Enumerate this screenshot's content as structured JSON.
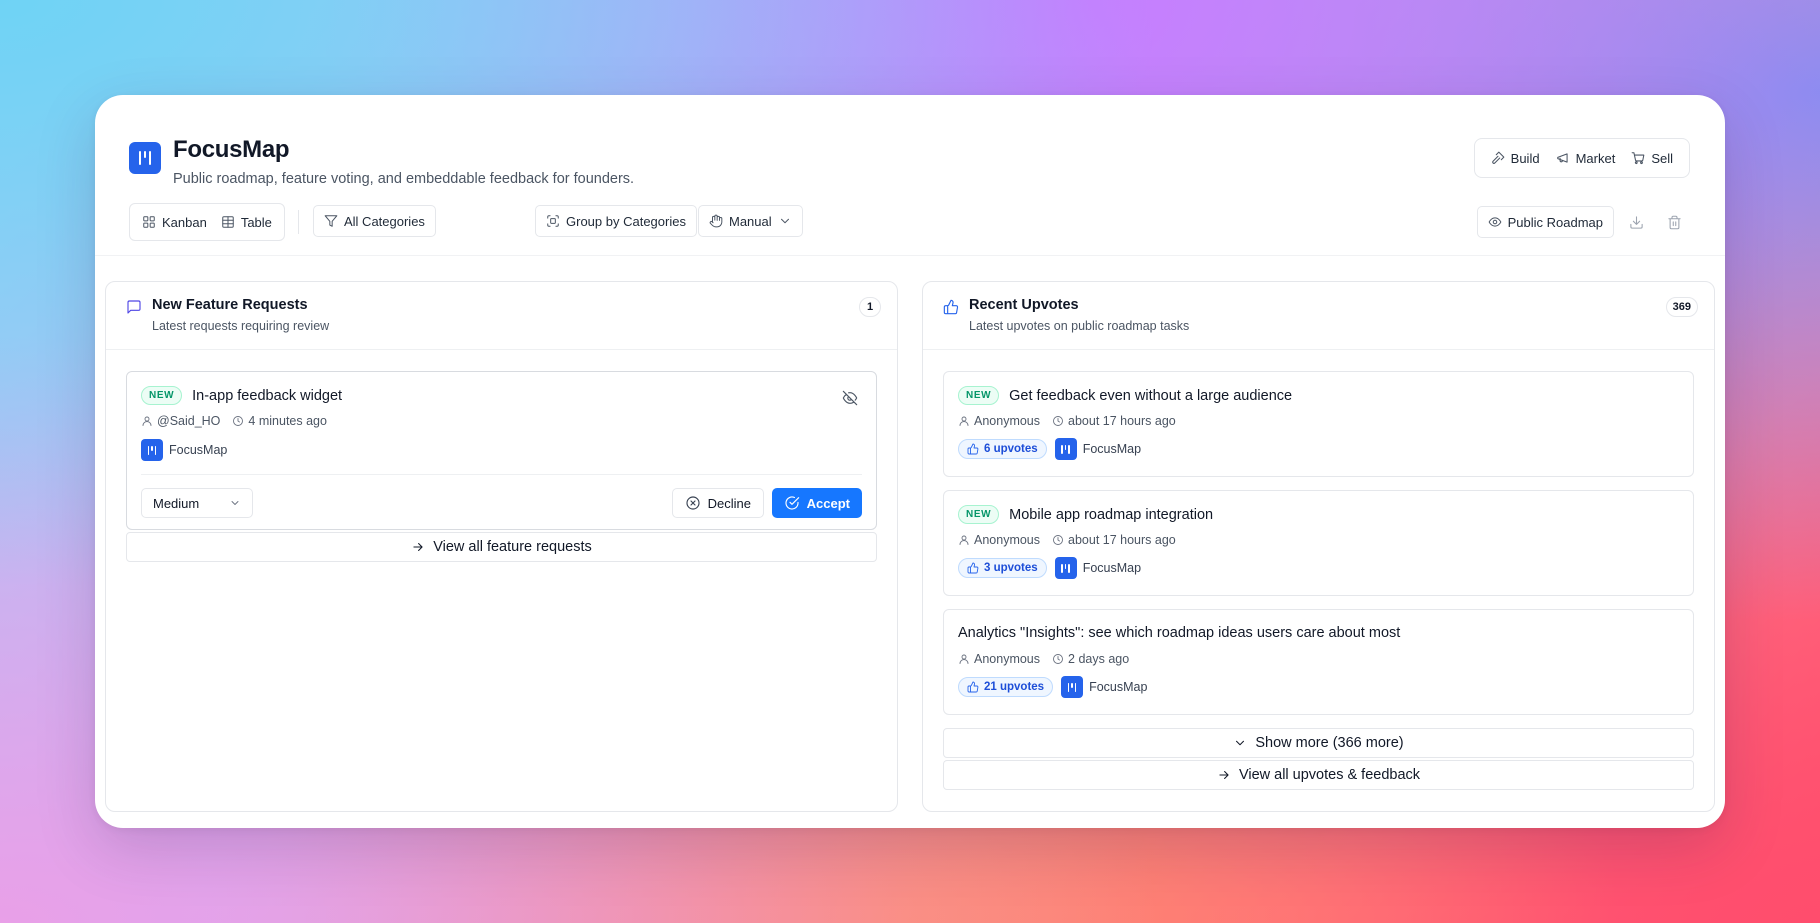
{
  "app": {
    "title": "FocusMap",
    "subtitle": "Public roadmap, feature voting, and embeddable feedback for founders.",
    "brand_color": "#2563eb"
  },
  "top_nav": [
    {
      "label": "Build",
      "icon": "hammer-icon"
    },
    {
      "label": "Market",
      "icon": "megaphone-icon"
    },
    {
      "label": "Sell",
      "icon": "cart-icon"
    }
  ],
  "toolbar": {
    "views": [
      {
        "label": "Kanban",
        "icon": "grid-icon"
      },
      {
        "label": "Table",
        "icon": "table-icon"
      }
    ],
    "filter_label": "All Categories",
    "group_label": "Group by Categories",
    "sort_label": "Manual",
    "public_roadmap_label": "Public Roadmap"
  },
  "feature_requests": {
    "title": "New Feature Requests",
    "description": "Latest requests requiring review",
    "count": "1",
    "items": [
      {
        "badge": "NEW",
        "title": "In-app feedback widget",
        "author": "@Said_HO",
        "time": "4 minutes ago",
        "project": "FocusMap",
        "priority": "Medium",
        "decline_label": "Decline",
        "accept_label": "Accept"
      }
    ],
    "view_all_label": "View all feature requests"
  },
  "upvotes": {
    "title": "Recent Upvotes",
    "description": "Latest upvotes on public roadmap tasks",
    "count": "369",
    "items": [
      {
        "badge": "NEW",
        "title": "Get feedback even without a large audience",
        "author": "Anonymous",
        "time": "about 17 hours ago",
        "upvotes": "6 upvotes",
        "project": "FocusMap"
      },
      {
        "badge": "NEW",
        "title": "Mobile app roadmap integration",
        "author": "Anonymous",
        "time": "about 17 hours ago",
        "upvotes": "3 upvotes",
        "project": "FocusMap"
      },
      {
        "badge": "",
        "title": "Analytics \"Insights\": see which roadmap ideas users care about most",
        "author": "Anonymous",
        "time": "2 days ago",
        "upvotes": "21 upvotes",
        "project": "FocusMap"
      }
    ],
    "show_more_label": "Show more (366 more)",
    "view_all_label": "View all upvotes & feedback"
  }
}
